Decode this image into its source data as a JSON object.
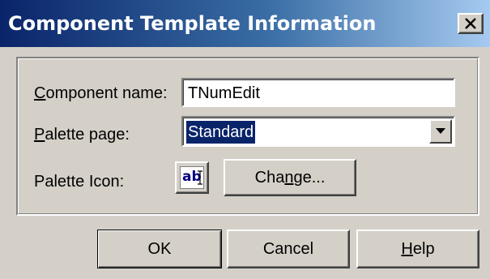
{
  "window": {
    "title": "Component Template Information",
    "close_glyph": "✕"
  },
  "form": {
    "component_name": {
      "label_underlined": "C",
      "label_rest": "omponent name:",
      "value": "TNumEdit"
    },
    "palette_page": {
      "label_underlined": "P",
      "label_rest": "alette page:",
      "selected_value": "Standard"
    },
    "palette_icon": {
      "label": "Palette Icon:",
      "icon_text": "ab",
      "icon_name": "text-edit-icon",
      "change_button": {
        "before": "Cha",
        "underlined": "n",
        "after": "ge..."
      }
    }
  },
  "buttons": {
    "ok": "OK",
    "cancel": "Cancel",
    "help_underlined": "H",
    "help_rest": "elp"
  },
  "colors": {
    "title_gradient_start": "#0a246a",
    "title_gradient_end": "#a6caf0",
    "face": "#d4d0c8",
    "selection": "#0a246a"
  }
}
